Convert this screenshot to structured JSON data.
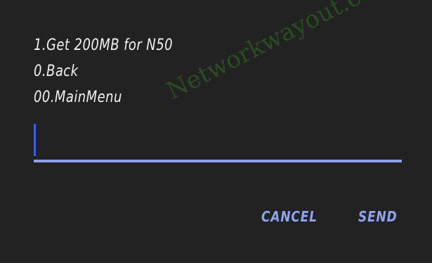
{
  "menu": {
    "items": [
      {
        "label": "1.Get 200MB for N50"
      },
      {
        "label": "0.Back"
      },
      {
        "label": "00.MainMenu"
      }
    ]
  },
  "input": {
    "value": "",
    "placeholder": ""
  },
  "watermark": {
    "text": "Networkwayout.com.ng"
  },
  "actions": {
    "cancel_label": "CANCEL",
    "send_label": "SEND"
  },
  "colors": {
    "background": "#222222",
    "menu_text": "#f2f2f2",
    "accent": "#8fa3f2",
    "caret": "#3f5fd6",
    "watermark": "#2b4f22"
  }
}
